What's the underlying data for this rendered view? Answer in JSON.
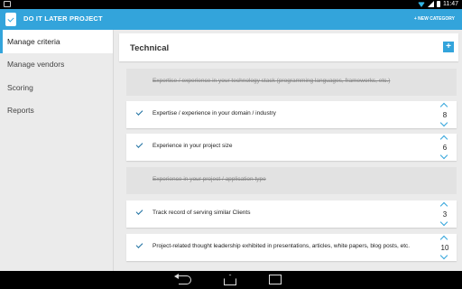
{
  "status_bar": {
    "time": "11:47"
  },
  "app_bar": {
    "title": "DO IT LATER PROJECT",
    "new_category": "+ NEW CATEGORY"
  },
  "sidebar": {
    "items": [
      {
        "label": "Manage criteria",
        "active": true
      },
      {
        "label": "Manage vendors",
        "active": false
      },
      {
        "label": "Scoring",
        "active": false
      },
      {
        "label": "Reports",
        "active": false
      }
    ]
  },
  "category": {
    "title": "Technical",
    "add_label": "+"
  },
  "criteria": [
    {
      "text": "Expertise / experience in your technology stack (programming languages, frameworks, etc.)",
      "enabled": false,
      "weight": ""
    },
    {
      "text": "Expertise / experience in your domain / industry",
      "enabled": true,
      "weight": "8"
    },
    {
      "text": "Experience in your project size",
      "enabled": true,
      "weight": "6"
    },
    {
      "text": "Experience in your project / application type",
      "enabled": false,
      "weight": ""
    },
    {
      "text": "Track record of serving similar Clients",
      "enabled": true,
      "weight": "3"
    },
    {
      "text": "Project-related thought leadership exhibited in presentations, articles, white papers, blog posts, etc.",
      "enabled": true,
      "weight": "10"
    }
  ],
  "colors": {
    "accent": "#33a4db",
    "check": "#1a6ea0",
    "background": "#ebebeb"
  },
  "icons": {
    "app": "clipboard-check-icon",
    "nav_back": "back-icon",
    "nav_home": "home-icon",
    "nav_recent": "recent-apps-icon"
  }
}
